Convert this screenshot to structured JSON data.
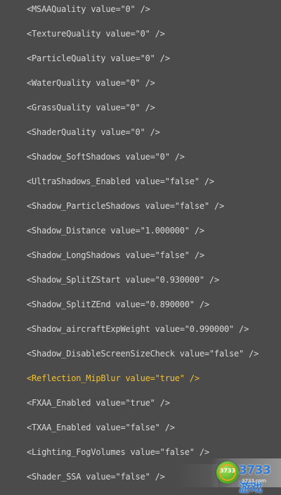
{
  "lines": [
    {
      "text": "<MSAAQuality value=\"0\" />",
      "highlight": false
    },
    {
      "text": "<TextureQuality value=\"0\" />",
      "highlight": false
    },
    {
      "text": "<ParticleQuality value=\"0\" />",
      "highlight": false
    },
    {
      "text": "<WaterQuality value=\"0\" />",
      "highlight": false
    },
    {
      "text": "<GrassQuality value=\"0\" />",
      "highlight": false
    },
    {
      "text": "<ShaderQuality value=\"0\" />",
      "highlight": false
    },
    {
      "text": "<Shadow_SoftShadows value=\"0\" />",
      "highlight": false
    },
    {
      "text": "<UltraShadows_Enabled value=\"false\" />",
      "highlight": false
    },
    {
      "text": "<Shadow_ParticleShadows value=\"false\" />",
      "highlight": false
    },
    {
      "text": "<Shadow_Distance value=\"1.000000\" />",
      "highlight": false
    },
    {
      "text": "<Shadow_LongShadows value=\"false\" />",
      "highlight": false
    },
    {
      "text": "<Shadow_SplitZStart value=\"0.930000\" />",
      "highlight": false
    },
    {
      "text": "<Shadow_SplitZEnd value=\"0.890000\" />",
      "highlight": false
    },
    {
      "text": "<Shadow_aircraftExpWeight value=\"0.990000\" />",
      "highlight": false
    },
    {
      "text": "<Shadow_DisableScreenSizeCheck value=\"false\" />",
      "highlight": false
    },
    {
      "text": "<Reflection_MipBlur value=\"true\" />",
      "highlight": true
    },
    {
      "text": "<FXAA_Enabled value=\"true\" />",
      "highlight": false
    },
    {
      "text": "<TXAA_Enabled value=\"false\" />",
      "highlight": false
    },
    {
      "text": "<Lighting_FogVolumes value=\"false\" />",
      "highlight": false
    },
    {
      "text": "<Shader_SSA value=\"false\" />",
      "highlight": false
    }
  ],
  "watermark": {
    "badge": "3733",
    "brand": "3733游戏",
    "domain": "3733.com"
  },
  "colors": {
    "background": "#4b4b4b",
    "text": "#d8d8d8",
    "highlight": "#f2c12e"
  }
}
